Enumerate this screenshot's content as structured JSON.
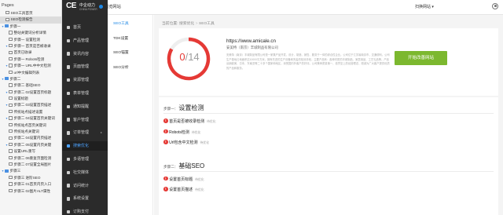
{
  "pages_panel": {
    "title": "Pages",
    "items": [
      {
        "label": "SEO工具首页",
        "kind": "page",
        "selected": false,
        "expanded": null
      },
      {
        "label": "SEO检测报告",
        "kind": "page",
        "selected": true,
        "expanded": null
      },
      {
        "label": "步骤一",
        "kind": "folder",
        "selected": false,
        "expanded": true
      },
      {
        "label": "整站关键词分析详情",
        "kind": "page",
        "selected": false,
        "expanded": null
      },
      {
        "label": "步骤一 设置检测",
        "kind": "page",
        "selected": false,
        "expanded": null
      },
      {
        "label": "步骤一 首页是否被收录",
        "kind": "page",
        "selected": false,
        "expanded": true
      },
      {
        "label": "首页已收录",
        "kind": "page",
        "selected": false,
        "expanded": null
      },
      {
        "label": "步骤一 Robots检测",
        "kind": "page",
        "selected": false,
        "expanded": null
      },
      {
        "label": "步骤一 URL中中文检测",
        "kind": "page",
        "selected": false,
        "expanded": true
      },
      {
        "label": "url中文编辑列表",
        "kind": "page",
        "selected": false,
        "expanded": null
      },
      {
        "label": "步骤二",
        "kind": "folder",
        "selected": false,
        "expanded": true
      },
      {
        "label": "步骤二 基础SEO",
        "kind": "page",
        "selected": false,
        "expanded": null
      },
      {
        "label": "步骤二 02设置首页标题",
        "kind": "page",
        "selected": false,
        "expanded": true
      },
      {
        "label": "设置标题",
        "kind": "page",
        "selected": false,
        "expanded": null
      },
      {
        "label": "步骤二 03设置首页描述",
        "kind": "page",
        "selected": false,
        "expanded": true
      },
      {
        "label": "传统站点描述设置",
        "kind": "page",
        "selected": false,
        "expanded": null
      },
      {
        "label": "步骤二 04设置首页关键词",
        "kind": "page",
        "selected": false,
        "expanded": true
      },
      {
        "label": "传统站点首页关键词",
        "kind": "page",
        "selected": false,
        "expanded": null
      },
      {
        "label": "传统站点关键词",
        "kind": "page",
        "selected": false,
        "expanded": null
      },
      {
        "label": "步骤二 04设置内页描述",
        "kind": "page",
        "selected": false,
        "expanded": null
      },
      {
        "label": "步骤二 05设置内页关键",
        "kind": "page",
        "selected": false,
        "expanded": true
      },
      {
        "label": "设置URL重写",
        "kind": "page",
        "selected": false,
        "expanded": null
      },
      {
        "label": "步骤二 06重复页面检测",
        "kind": "page",
        "selected": false,
        "expanded": null
      },
      {
        "label": "步骤二 07设置全局图片",
        "kind": "page",
        "selected": false,
        "expanded": null
      },
      {
        "label": "步骤三",
        "kind": "folder",
        "selected": false,
        "expanded": true
      },
      {
        "label": "步骤三 进阶SEO",
        "kind": "page",
        "selected": false,
        "expanded": null
      },
      {
        "label": "步骤三 01首页内页入口",
        "kind": "page",
        "selected": false,
        "expanded": null
      },
      {
        "label": "步骤三 02图片ALT属性",
        "kind": "page",
        "selected": false,
        "expanded": null
      }
    ]
  },
  "header": {
    "brand": "中企动力",
    "brand_mark": "CE",
    "brand_sub": "CHINA POWER",
    "site_link": "浏览网站",
    "account_label": "扫换网站 ▾"
  },
  "nav": {
    "items": [
      {
        "label": "首页",
        "active": false,
        "caret": false
      },
      {
        "label": "产品管理",
        "active": false,
        "caret": false
      },
      {
        "label": "资讯内容",
        "active": false,
        "caret": false
      },
      {
        "label": "页面管理",
        "active": false,
        "caret": false
      },
      {
        "label": "资源管理",
        "active": false,
        "caret": false
      },
      {
        "label": "表单管理",
        "active": false,
        "caret": false
      },
      {
        "label": "通知提醒",
        "active": false,
        "caret": false
      },
      {
        "label": "客户管理",
        "active": false,
        "caret": false
      },
      {
        "label": "订单管理",
        "active": false,
        "caret": true
      },
      {
        "label": "搜索优化",
        "active": true,
        "caret": false
      },
      {
        "label": "多语管理",
        "active": false,
        "caret": false
      },
      {
        "label": "社交媒体",
        "active": false,
        "caret": false
      },
      {
        "label": "访问统计",
        "active": false,
        "caret": false
      },
      {
        "label": "系统设置",
        "active": false,
        "caret": false
      },
      {
        "label": "订购支付",
        "active": false,
        "caret": false
      }
    ]
  },
  "subnav": {
    "items": [
      {
        "label": "SEO工具",
        "active": true
      },
      {
        "label": "TDK设置",
        "active": false
      },
      {
        "label": "SEO锚置",
        "active": false
      },
      {
        "label": "SEO分析",
        "active": false
      }
    ]
  },
  "breadcrumb": [
    "当前位置:",
    "搜索优化",
    ">",
    "SEO工具"
  ],
  "summary": {
    "score": 0,
    "total": 14,
    "score_text": "0",
    "total_text": "/14",
    "site_url": "https://www.amicale.cn",
    "site_meta": "安美特（南京）丰城制品有限公司",
    "description": "安美特（南京）丰城制品有限公司是一家集产品开发、设计、制造、销售、服务于一体的综合性企业。公司位于江苏省南京市，交通便利。公司生产基地占地面积达10000平方米，拥有先进的生产设备和完善的检测手段，主要产品有：各种材质的丰城制品、家居用品、工艺礼品等。产品远销欧美、日本、东南亚等二十多个国家和地区，深受国内外客户的好评。公司秉承质量第一、信誉至上的经营理念，竭诚为广大客户提供优质的产品和服务。",
    "button_label": "开始改善网站"
  },
  "steps": [
    {
      "prefix": "步骤一：",
      "title": "设置检测",
      "checks": [
        {
          "label": "首页是否被收录检测",
          "status": "待优化"
        },
        {
          "label": "Robots检测",
          "status": "待优化"
        },
        {
          "label": "Url包含中文检测",
          "status": "待优化"
        }
      ]
    },
    {
      "prefix": "步骤二：",
      "title": "基础SEO",
      "checks": [
        {
          "label": "设置首页标题",
          "status": "待优化"
        },
        {
          "label": "设置首页描述",
          "status": "待优化"
        }
      ]
    }
  ],
  "colors": {
    "accent": "#4da3ff",
    "nav_bg": "#2b2b2b",
    "warn": "#e53935",
    "button": "#7cb82f"
  }
}
